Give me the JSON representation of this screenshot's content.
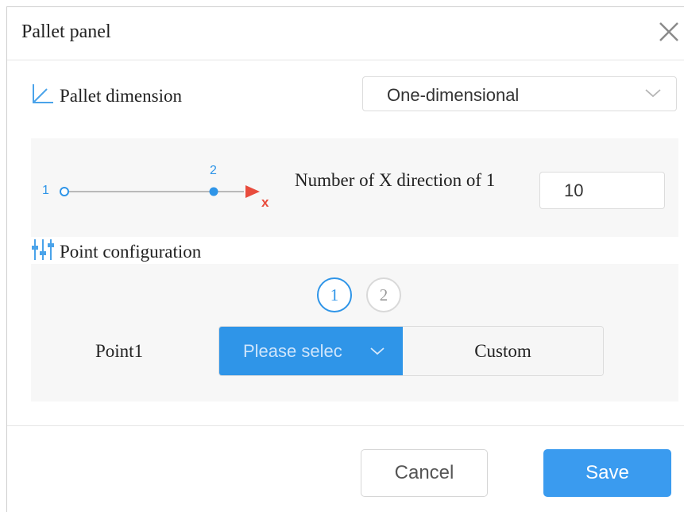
{
  "dialog": {
    "title": "Pallet panel"
  },
  "pallet_dimension": {
    "label": "Pallet dimension",
    "selected": "One-dimensional"
  },
  "diagram": {
    "start_label": "1",
    "point2_label": "2",
    "axis_label": "x"
  },
  "x_count": {
    "label": "Number of X direction of 1",
    "value": "10"
  },
  "point_config": {
    "label": "Point configuration",
    "steps": [
      "1",
      "2"
    ],
    "point_label": "Point1",
    "select_placeholder": "Please selec",
    "custom_label": "Custom"
  },
  "footer": {
    "cancel_label": "Cancel",
    "save_label": "Save"
  },
  "colors": {
    "accent": "#2f95e8",
    "save": "#3a9bef",
    "diagram_arrow": "#e84c3d"
  }
}
